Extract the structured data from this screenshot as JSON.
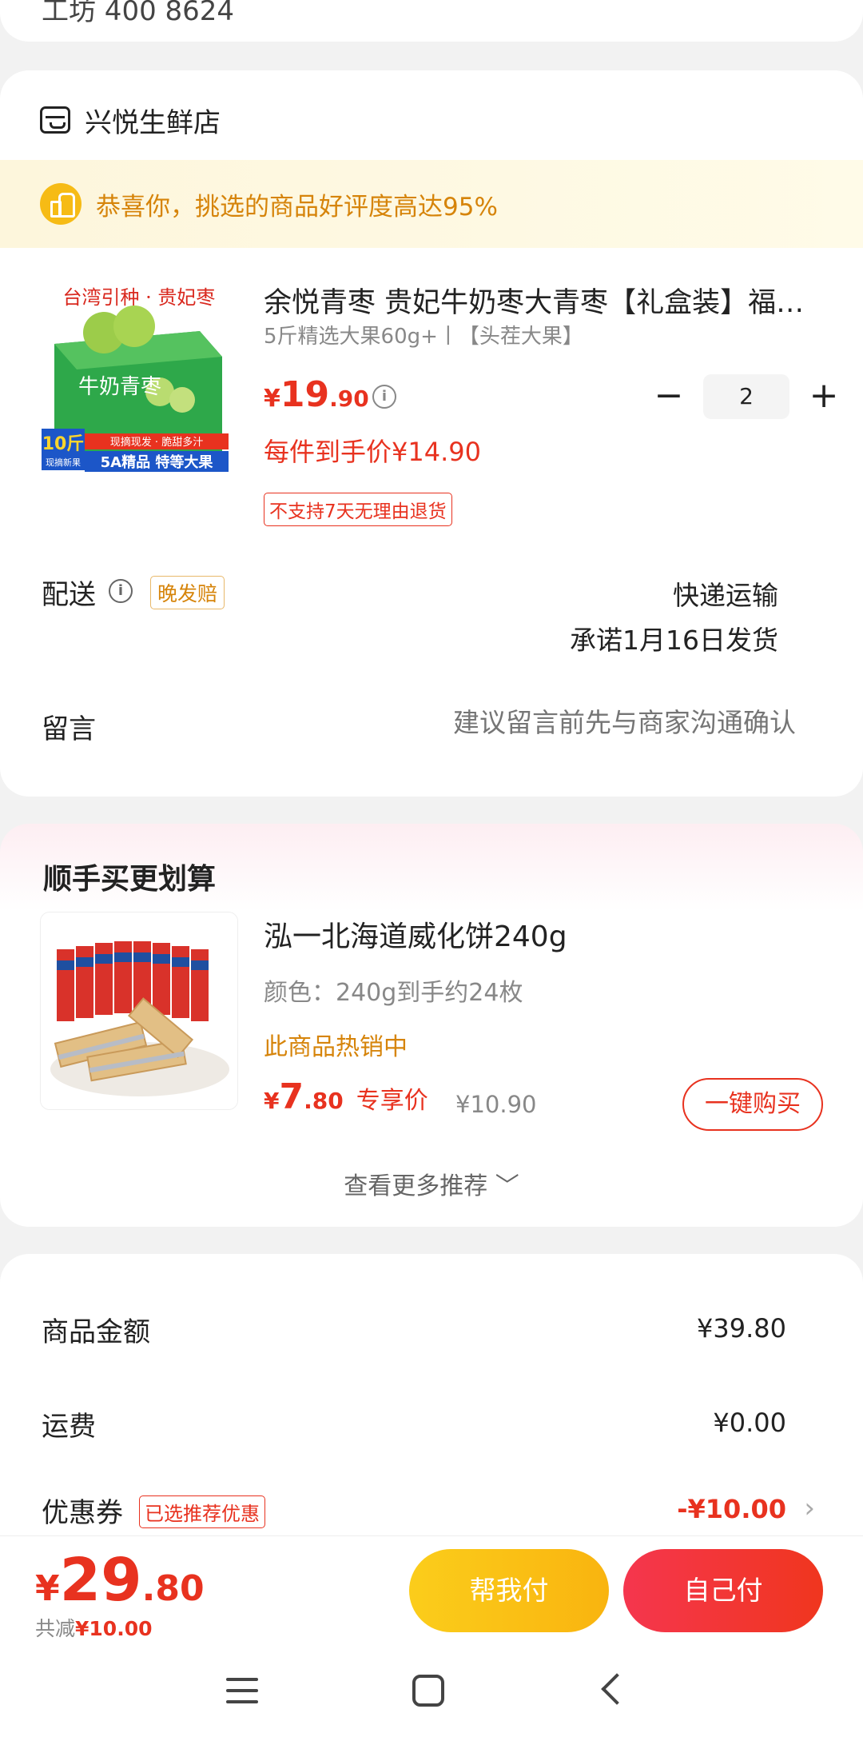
{
  "top_card": {
    "clipped_text": "工坊 400   8624"
  },
  "store": {
    "name": "兴悦生鲜店",
    "banner": "恭喜你，挑选的商品好评度高达95%",
    "product": {
      "image_caption_top": "台湾引种 · 贵妃枣",
      "image_box_text": "牛奶青枣",
      "image_badge_weight": "10斤",
      "image_badge_sub": "现摘新果",
      "image_line1": "现摘现发 · 脆甜多汁",
      "image_line2": "5A精品 特等大果",
      "title": "余悦青枣 贵妃牛奶枣大青枣【礼盒装】福建台湾青枣新鲜水果",
      "spec": "5斤精选大果60g+丨【头茬大果】",
      "price_yen": "¥",
      "price_int": "19",
      "price_dec": ".90",
      "quantity": "2",
      "minus": "−",
      "plus": "+",
      "unit_price": "每件到手价¥14.90",
      "return_notice": "不支持7天无理由退货"
    },
    "delivery": {
      "label": "配送",
      "late_badge": "晚发赔",
      "method": "快递运输",
      "promise": "承诺1月16日发货"
    },
    "message": {
      "label": "留言",
      "placeholder": "建议留言前先与商家沟通确认"
    }
  },
  "recommend": {
    "title": "顺手买更划算",
    "item": {
      "name": "泓一北海道威化饼240g",
      "color": "颜色：240g到手约24枚",
      "hot": "此商品热销中",
      "price_yen": "¥",
      "price_int": "7",
      "price_dec": ".80",
      "price_tag": "专享价",
      "original_price": "¥10.90",
      "buy_label": "一键购买"
    },
    "more": "查看更多推荐 ﹀"
  },
  "summary": {
    "goods_label": "商品金额",
    "goods_value": "¥39.80",
    "shipping_label": "运费",
    "shipping_value": "¥0.00",
    "coupon_label": "优惠券",
    "coupon_badge": "已选推荐优惠",
    "coupon_value": "-¥10.00",
    "chevron": "›"
  },
  "bottom": {
    "total_yen": "¥",
    "total_int": "29",
    "total_dec": ".80",
    "saved_prefix": "共减",
    "saved_value": "¥10.00",
    "help_pay": "帮我付",
    "self_pay": "自己付"
  },
  "colors": {
    "accent_red": "#e8321f",
    "accent_orange": "#d6840a",
    "help_btn": "#f9b40f",
    "self_btn": "#f0361e"
  },
  "icons": [
    "store-icon",
    "thumbs-up-icon",
    "info-icon",
    "chevron-right-icon",
    "menu-icon",
    "home-icon",
    "back-icon"
  ]
}
